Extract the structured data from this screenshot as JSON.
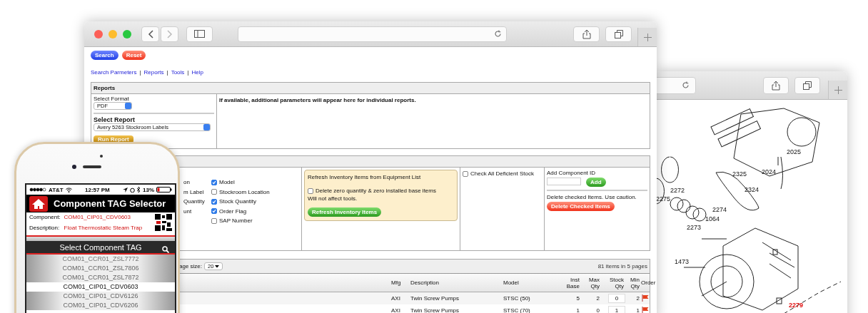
{
  "main_window": {
    "buttons": [
      {
        "label": "Search",
        "kind": "primary"
      },
      {
        "label": "Reset",
        "kind": "danger"
      }
    ],
    "links": [
      "Search Parmeters",
      "Reports",
      "Tools",
      "Help"
    ],
    "link_separator": "|",
    "reports": {
      "title": "Reports",
      "format_label": "Select Format",
      "format_value": "PDF",
      "report_label": "Select Report",
      "report_value": "Avery 5263 Stockroom Labels",
      "run_button": "Run Report",
      "note": "If available, additional parameters will appear here for individual reports."
    },
    "options": {
      "cut_labels": [
        "on",
        "m Label",
        "Quantity",
        "unt"
      ],
      "columns": [
        {
          "label": "Model",
          "checked": true
        },
        {
          "label": "Stockroom Location",
          "checked": false
        },
        {
          "label": "Stock Quantity",
          "checked": true
        },
        {
          "label": "Order Flag",
          "checked": true
        },
        {
          "label": "SAP Number",
          "checked": false
        }
      ],
      "refresh_box": {
        "title": "Refresh Inventory Items from Equipment List",
        "delete_option": {
          "label": "Delete zero quantity & zero installed base items",
          "checked": false
        },
        "note": "Will not affect tools.",
        "button": "Refresh Inventory Items"
      },
      "deficient": {
        "label": "Check All Deficient Stock",
        "checked": false
      },
      "add_label": "Add Component ID",
      "add_button": "Add",
      "delete_note": "Delete checked Items. Use caution.",
      "delete_button": "Delete Checked Items"
    },
    "grid": {
      "page_size_label": "age size:",
      "page_size": "20",
      "summary": "81 items in 5 pages",
      "columns": [
        "Mfg",
        "Description",
        "Model",
        "Inst Base",
        "Max Qty",
        "Stock Qty",
        "Min Qty",
        "Order"
      ],
      "rows": [
        {
          "mfg": "AXI",
          "description": "Twin Screw Pumps",
          "model": "STSC (50)",
          "inst_base": "5",
          "max_qty": "2",
          "stock_qty": "0",
          "min_qty": "2",
          "order_flag": true
        },
        {
          "mfg": "AXI",
          "description": "Twin Screw Pumps",
          "model": "STSC (70)",
          "inst_base": "1",
          "max_qty": "0",
          "stock_qty": "1",
          "min_qty": "1",
          "order_flag": true
        }
      ]
    }
  },
  "back_window": {
    "callouts": [
      {
        "label": "2025",
        "highlighted": false
      },
      {
        "label": "2024",
        "highlighted": false
      },
      {
        "label": "2325",
        "highlighted": false
      },
      {
        "label": "2324",
        "highlighted": false
      },
      {
        "label": "2272",
        "highlighted": false
      },
      {
        "label": "2275",
        "highlighted": false
      },
      {
        "label": "2274",
        "highlighted": false
      },
      {
        "label": "1064",
        "highlighted": false
      },
      {
        "label": "2273",
        "highlighted": false
      },
      {
        "label": "1473",
        "highlighted": false
      },
      {
        "label": "2279",
        "highlighted": true
      }
    ]
  },
  "phone": {
    "carrier": "AT&T",
    "time": "12:57 PM",
    "battery": "13%",
    "title": "Component TAG Selector",
    "component_label": "Component:",
    "component_value": "COM01_CIP01_CDV0603",
    "description_label": "Description:",
    "description_value": "Float Thermostatic Steam Trap",
    "select_title": "Select Component TAG",
    "tags": [
      {
        "label": "COM01_CCR01_ZSL7772",
        "selected": false
      },
      {
        "label": "COM01_CCR01_ZSL7806",
        "selected": false
      },
      {
        "label": "COM01_CCR01_ZSL7872",
        "selected": false
      },
      {
        "label": "COM01_CIP01_CDV0603",
        "selected": true
      },
      {
        "label": "COM01_CIP01_CDV6126",
        "selected": false
      },
      {
        "label": "COM01_CIP01_CDV6206",
        "selected": false
      }
    ]
  }
}
